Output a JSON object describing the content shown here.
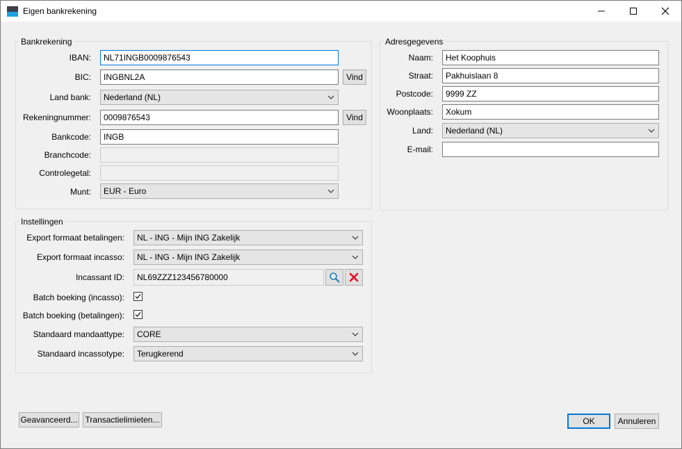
{
  "window": {
    "title": "Eigen bankrekening"
  },
  "bank": {
    "group_label": "Bankrekening",
    "iban_label": "IBAN:",
    "iban": "NL71INGB0009876543",
    "bic_label": "BIC:",
    "bic": "INGBNL2A",
    "land_label": "Land bank:",
    "land": "Nederland (NL)",
    "rek_label": "Rekeningnummer:",
    "rek": "0009876543",
    "bankcode_label": "Bankcode:",
    "bankcode": "INGB",
    "branchcode_label": "Branchcode:",
    "branchcode": "",
    "controle_label": "Controlegetal:",
    "controle": "",
    "munt_label": "Munt:",
    "munt": "EUR - Euro",
    "vind_label": "Vind"
  },
  "adres": {
    "group_label": "Adresgegevens",
    "naam_label": "Naam:",
    "naam": "Het Koophuis",
    "straat_label": "Straat:",
    "straat": "Pakhuislaan 8",
    "postcode_label": "Postcode:",
    "postcode": "9999 ZZ",
    "woonplaats_label": "Woonplaats:",
    "woonplaats": "Xokum",
    "land_label": "Land:",
    "land": "Nederland (NL)",
    "email_label": "E-mail:",
    "email": ""
  },
  "instellingen": {
    "group_label": "Instellingen",
    "export_betalingen_label": "Export formaat betalingen:",
    "export_betalingen": "NL - ING - Mijn ING Zakelijk",
    "export_incasso_label": "Export formaat incasso:",
    "export_incasso": "NL - ING - Mijn ING Zakelijk",
    "incassant_label": "Incassant ID:",
    "incassant": "NL69ZZZ123456780000",
    "batch_incasso_label": "Batch boeking (incasso):",
    "batch_incasso": true,
    "batch_betalingen_label": "Batch boeking (betalingen):",
    "batch_betalingen": true,
    "mandaattype_label": "Standaard mandaattype:",
    "mandaattype": "CORE",
    "incassotype_label": "Standaard incassotype:",
    "incassotype": "Terugkerend"
  },
  "footer": {
    "geavanceerd": "Geavanceerd...",
    "transactielimieten": "Transactielimieten...",
    "ok": "OK",
    "annuleren": "Annuleren"
  },
  "colors": {
    "accent": "#0078d7",
    "delete": "#e81123",
    "search": "#2a7ab0"
  },
  "icons": {
    "app": "app-icon",
    "minimize": "minimize-icon",
    "maximize": "maximize-icon",
    "close": "close-icon",
    "dropdown": "chevron-down-icon",
    "search": "search-icon",
    "delete": "delete-icon",
    "check": "check-icon"
  }
}
